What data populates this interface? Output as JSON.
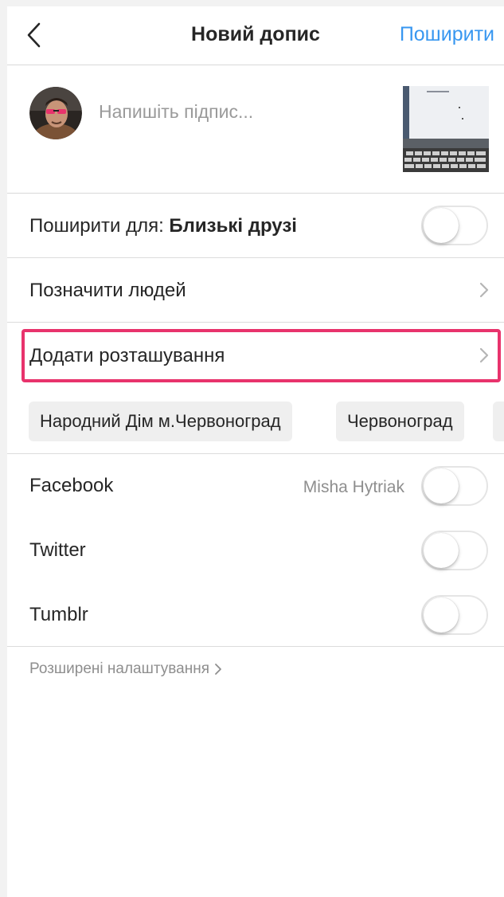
{
  "header": {
    "title": "Новий допис",
    "share_label": "Поширити"
  },
  "caption": {
    "placeholder": "Напишіть підпис..."
  },
  "share_to": {
    "label_prefix": "Поширити для: ",
    "label_bold": "Близькі друзі",
    "toggle_on": false
  },
  "tag_people": {
    "label": "Позначити людей"
  },
  "add_location": {
    "label": "Додати розташування"
  },
  "location_suggestions": [
    "Народний Дім м.Червоноград",
    "Червоноград"
  ],
  "social": {
    "facebook": {
      "label": "Facebook",
      "account": "Misha Hytriak",
      "toggle_on": false
    },
    "twitter": {
      "label": "Twitter",
      "toggle_on": false
    },
    "tumblr": {
      "label": "Tumblr",
      "toggle_on": false
    }
  },
  "advanced": {
    "label": "Розширені налаштування"
  },
  "colors": {
    "accent": "#3897f0",
    "highlight": "#e8336c"
  }
}
